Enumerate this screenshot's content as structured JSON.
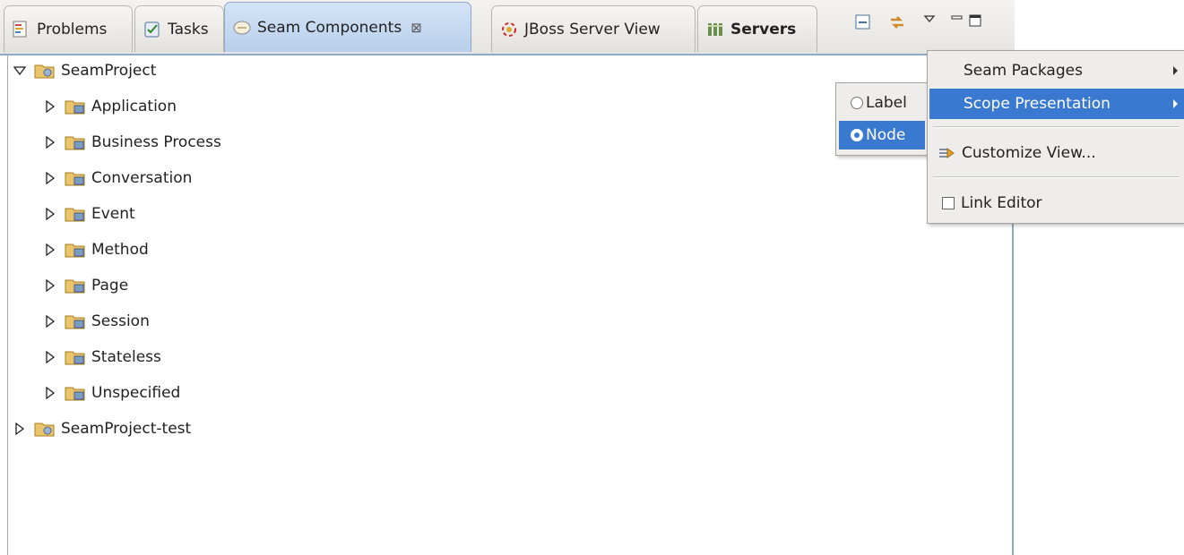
{
  "tabs": [
    {
      "label": "Problems",
      "icon": "problems-icon"
    },
    {
      "label": "Tasks",
      "icon": "tasks-icon"
    },
    {
      "label": "Seam Components",
      "icon": "seam-components-icon",
      "active": true,
      "close_glyph": "⊠"
    },
    {
      "label": "JBoss Server View",
      "icon": "jboss-server-icon"
    },
    {
      "label": "Servers",
      "icon": "servers-icon",
      "bold": true
    }
  ],
  "view_toolbar": [
    "collapse-all-icon",
    "link-with-editor-icon",
    "view-menu-icon",
    "minimize-icon",
    "maximize-icon"
  ],
  "tree": {
    "root": {
      "label": "SeamProject",
      "expanded": true
    },
    "scopes": [
      "Application",
      "Business Process",
      "Conversation",
      "Event",
      "Method",
      "Page",
      "Session",
      "Stateless",
      "Unspecified"
    ],
    "second_root": {
      "label": "SeamProject-test",
      "expanded": false
    }
  },
  "view_menu": {
    "items": [
      {
        "label": "Seam Packages",
        "submenu": true
      },
      {
        "label": "Scope Presentation",
        "submenu": true,
        "selected": true
      },
      {
        "label": "Customize View..."
      },
      {
        "label": "Link Editor",
        "checked": false
      }
    ]
  },
  "scope_submenu": {
    "options": [
      {
        "label": "Label",
        "selected": false
      },
      {
        "label": "Node",
        "selected": true
      }
    ]
  },
  "colors": {
    "selection": "#3a79d0",
    "border_blue": "#8fa9c9",
    "tree_text": "#222222"
  }
}
